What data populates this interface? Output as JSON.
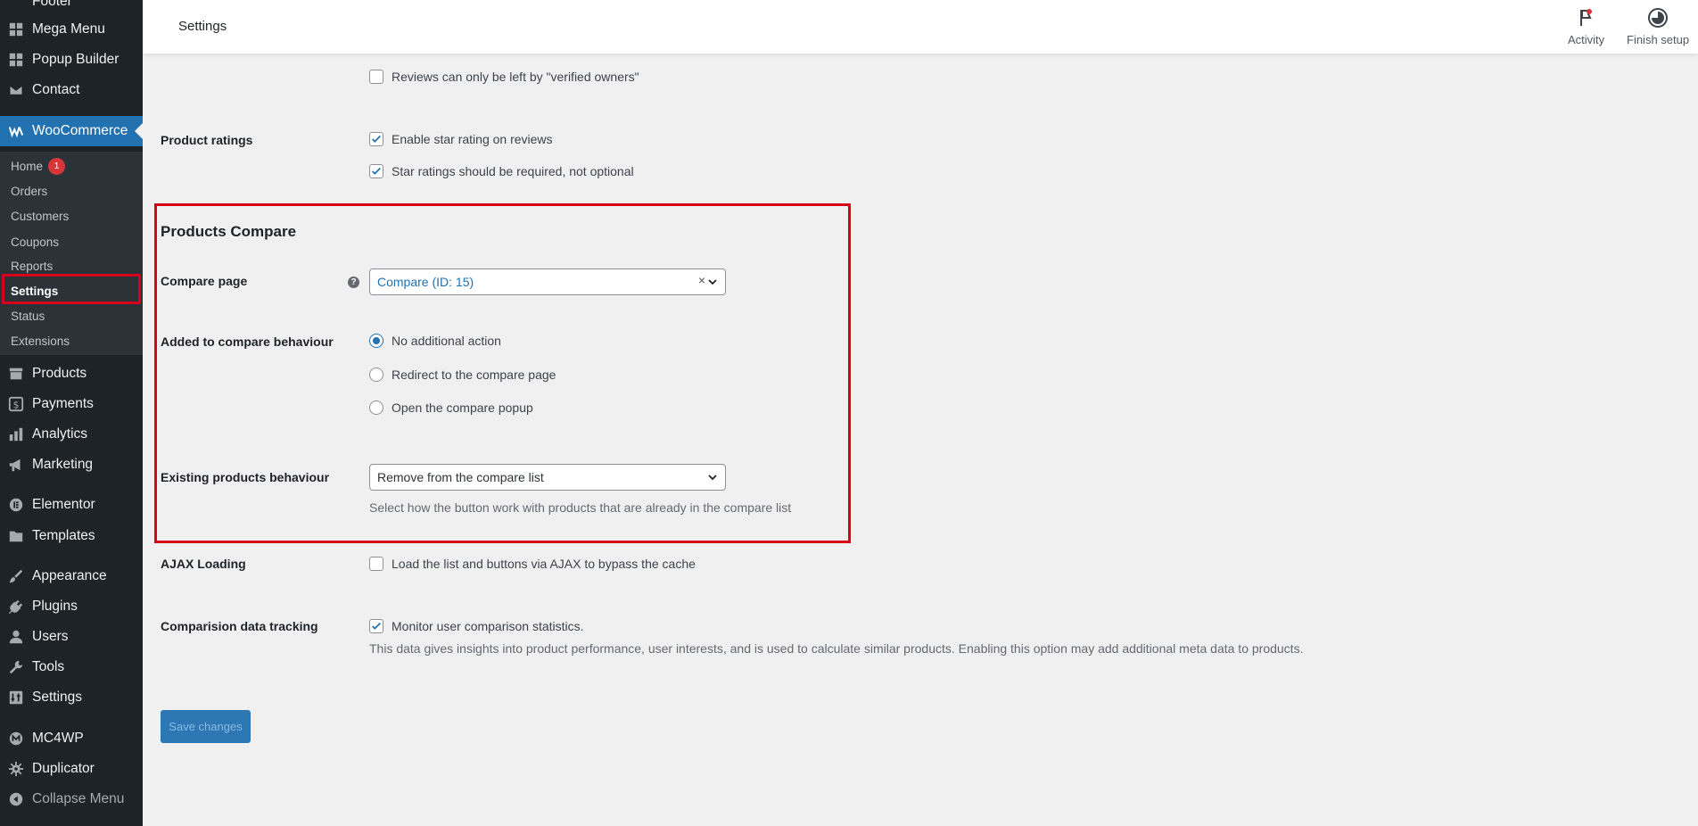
{
  "sidebar": {
    "items_top": [
      {
        "label": "Footer",
        "icon": "layout-icon"
      },
      {
        "label": "Mega Menu",
        "icon": "grid-icon"
      },
      {
        "label": "Popup Builder",
        "icon": "grid-icon"
      },
      {
        "label": "Contact",
        "icon": "envelope-icon"
      }
    ],
    "woocommerce": {
      "label": "WooCommerce",
      "icon": "woocommerce-icon"
    },
    "submenu": [
      {
        "label": "Home",
        "badge": "1"
      },
      {
        "label": "Orders"
      },
      {
        "label": "Customers"
      },
      {
        "label": "Coupons"
      },
      {
        "label": "Reports"
      },
      {
        "label": "Settings"
      },
      {
        "label": "Status"
      },
      {
        "label": "Extensions"
      }
    ],
    "items_bottom": [
      {
        "label": "Products",
        "icon": "archive-icon"
      },
      {
        "label": "Payments",
        "icon": "dollar-icon"
      },
      {
        "label": "Analytics",
        "icon": "bar-chart-icon"
      },
      {
        "label": "Marketing",
        "icon": "megaphone-icon"
      },
      {
        "label": "Elementor",
        "icon": "elementor-icon"
      },
      {
        "label": "Templates",
        "icon": "folder-icon"
      },
      {
        "label": "Appearance",
        "icon": "brush-icon"
      },
      {
        "label": "Plugins",
        "icon": "plug-icon"
      },
      {
        "label": "Users",
        "icon": "user-icon"
      },
      {
        "label": "Tools",
        "icon": "wrench-icon"
      },
      {
        "label": "Settings",
        "icon": "sliders-icon"
      },
      {
        "label": "MC4WP",
        "icon": "mc4wp-icon"
      },
      {
        "label": "Duplicator",
        "icon": "gear-icon"
      },
      {
        "label": "Collapse Menu",
        "icon": "collapse-icon"
      }
    ]
  },
  "header": {
    "title": "Settings",
    "activity": "Activity",
    "finish_setup": "Finish setup"
  },
  "content": {
    "verified_owners": "Reviews can only be left by \"verified owners\"",
    "product_ratings": {
      "label": "Product ratings",
      "enable_star": "Enable star rating on reviews",
      "star_required": "Star ratings should be required, not optional"
    },
    "compare": {
      "title": "Products Compare",
      "compare_page_label": "Compare page",
      "compare_page_value": "Compare (ID: 15)",
      "behaviour_label": "Added to compare behaviour",
      "behaviour_options": [
        "No additional action",
        "Redirect to the compare page",
        "Open the compare popup"
      ],
      "existing_label": "Existing products behaviour",
      "existing_value": "Remove from the compare list",
      "existing_desc": "Select how the button work with products that are already in the compare list"
    },
    "ajax": {
      "label": "AJAX Loading",
      "text": "Load the list and buttons via AJAX to bypass the cache"
    },
    "tracking": {
      "label": "Comparision data tracking",
      "text": "Monitor user comparison statistics.",
      "desc": "This data gives insights into product performance, user interests, and is used to calculate similar products. Enabling this option may add additional meta data to products."
    },
    "save_label": "Save changes"
  },
  "colors": {
    "sidebar_bg": "#1d2327",
    "submenu_bg": "#2c3338",
    "accent": "#2271b1",
    "highlight": "#d9001b"
  }
}
